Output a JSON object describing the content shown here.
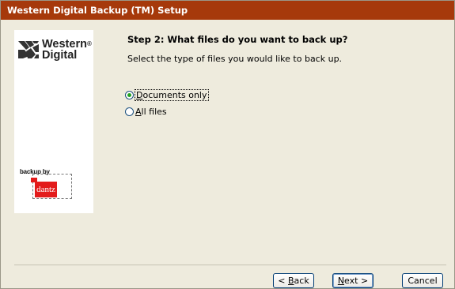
{
  "window": {
    "title": "Western Digital Backup (TM) Setup"
  },
  "logo": {
    "brand_line1": "Western",
    "brand_reg": "®",
    "brand_line2": "Digital",
    "backup_by": "backup by",
    "dantz": "dantz"
  },
  "step": {
    "heading": "Step 2: What files do you want to back up?",
    "description": "Select the type of files you would like to back up."
  },
  "options": [
    {
      "label": "Documents only",
      "accesskey": "D",
      "selected": true
    },
    {
      "label": "All files",
      "accesskey": "A",
      "selected": false
    }
  ],
  "buttons": {
    "back": "< Back",
    "back_key": "B",
    "next": "Next >",
    "next_key": "N",
    "cancel": "Cancel"
  },
  "colors": {
    "titlebar": "#a6390b",
    "dialog_bg": "#eeebdd",
    "radio_dot": "#21a121",
    "dantz_red": "#e31b1b"
  }
}
